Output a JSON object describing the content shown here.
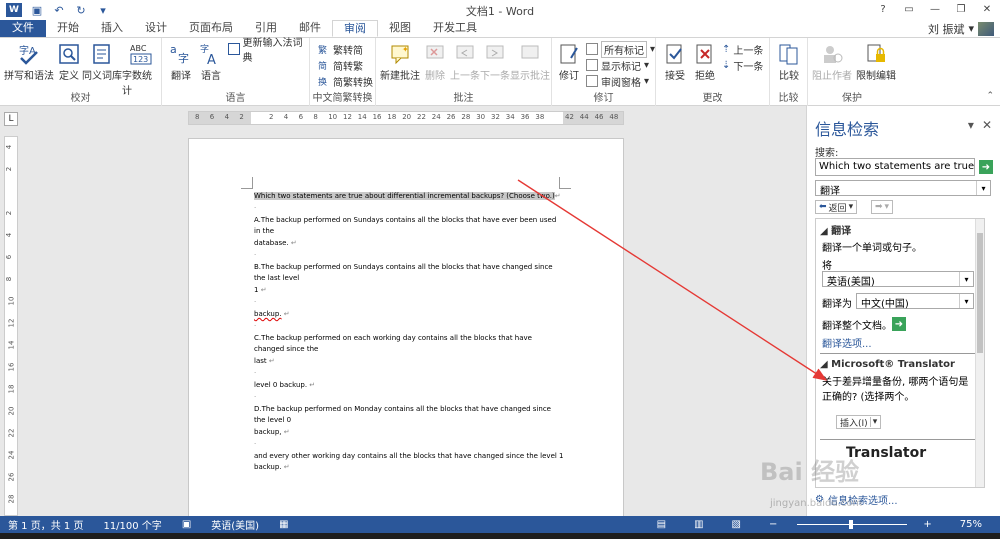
{
  "window": {
    "title": "文档1 - Word",
    "user": "刘 振斌"
  },
  "tabs": [
    "文件",
    "开始",
    "插入",
    "设计",
    "页面布局",
    "引用",
    "邮件",
    "审阅",
    "视图",
    "开发工具"
  ],
  "ribbon": {
    "proofing": {
      "label": "校对",
      "spell": "拼写和语法",
      "define": "定义",
      "thesaurus": "同义词库",
      "wordcount": "字数统计"
    },
    "language": {
      "label": "语言",
      "translate": "翻译",
      "lang": "语言",
      "update_ime": "更新输入法词典"
    },
    "chinese": {
      "label": "中文简繁转换",
      "to_trad": "繁转简",
      "to_simp": "简转繁",
      "convert": "简繁转换"
    },
    "comments": {
      "label": "批注",
      "new": "新建批注",
      "delete": "删除",
      "prev": "上一条",
      "next": "下一条",
      "show": "显示批注"
    },
    "tracking": {
      "label": "修订",
      "track": "修订",
      "all_markup": "所有标记",
      "show_markup": "显示标记",
      "pane": "审阅窗格"
    },
    "changes": {
      "label": "更改",
      "accept": "接受",
      "reject": "拒绝",
      "prev": "上一条",
      "next": "下一条"
    },
    "compare": {
      "label": "比较",
      "compare": "比较"
    },
    "protect": {
      "label": "保护",
      "block": "阻止作者",
      "restrict": "限制编辑"
    }
  },
  "ruler": {
    "labels": [
      "8",
      "6",
      "4",
      "2",
      "",
      "2",
      "4",
      "6",
      "8",
      "10",
      "12",
      "14",
      "16",
      "18",
      "20",
      "22",
      "24",
      "26",
      "28",
      "30",
      "32",
      "34",
      "36",
      "38",
      "",
      "42",
      "44",
      "46",
      "48"
    ],
    "vlabels": [
      "4",
      "2",
      "",
      "2",
      "4",
      "6",
      "8",
      "10",
      "12",
      "14",
      "16",
      "18",
      "20",
      "22",
      "24",
      "26",
      "28"
    ]
  },
  "document": {
    "question": "Which two statements are true about differential incremental backups? (Choose two.)",
    "a": "A.The backup performed on Sundays contains all the blocks that have ever been used in the",
    "a2": "database.",
    "b": "B.The backup performed on Sundays contains all the blocks that have changed since the last level",
    "b2": "1",
    "b3": "backup.",
    "c": "C.The backup performed on each working day contains all the blocks that have changed since the",
    "c2": "last",
    "c3": "level 0 backup.",
    "d": "D.The backup performed on Monday contains all the blocks that have changed since the level 0",
    "d2": "backup,",
    "d3": "and every other working day contains all the blocks that have changed since the level 1 backup."
  },
  "pane": {
    "title": "信息检索",
    "search_label": "搜索:",
    "search_value": "Which two statements are true abo",
    "service": "翻译",
    "back": "返回",
    "section_translate": "翻译",
    "translate_hint": "翻译一个单词或句子。",
    "from_label": "将",
    "from_lang": "英语(美国)",
    "to_label": "翻译为",
    "to_lang": "中文(中国)",
    "translate_doc": "翻译整个文档。",
    "options": "翻译选项...",
    "section_ms": "Microsoft® Translator",
    "result": "关于差异增量备份, 哪两个语句是正确的? (选择两个。",
    "insert": "插入(I)",
    "logo": "Translator",
    "footer": "信息检索选项..."
  },
  "status": {
    "page": "第 1 页，共 1 页",
    "words": "11/100 个字",
    "lang": "英语(美国)",
    "zoom": "75%"
  },
  "watermark": {
    "main": "Bai 经验",
    "sub": "jingyan.baidu.com"
  },
  "colors": {
    "accent": "#2b579a",
    "arrow": "#e53935"
  }
}
